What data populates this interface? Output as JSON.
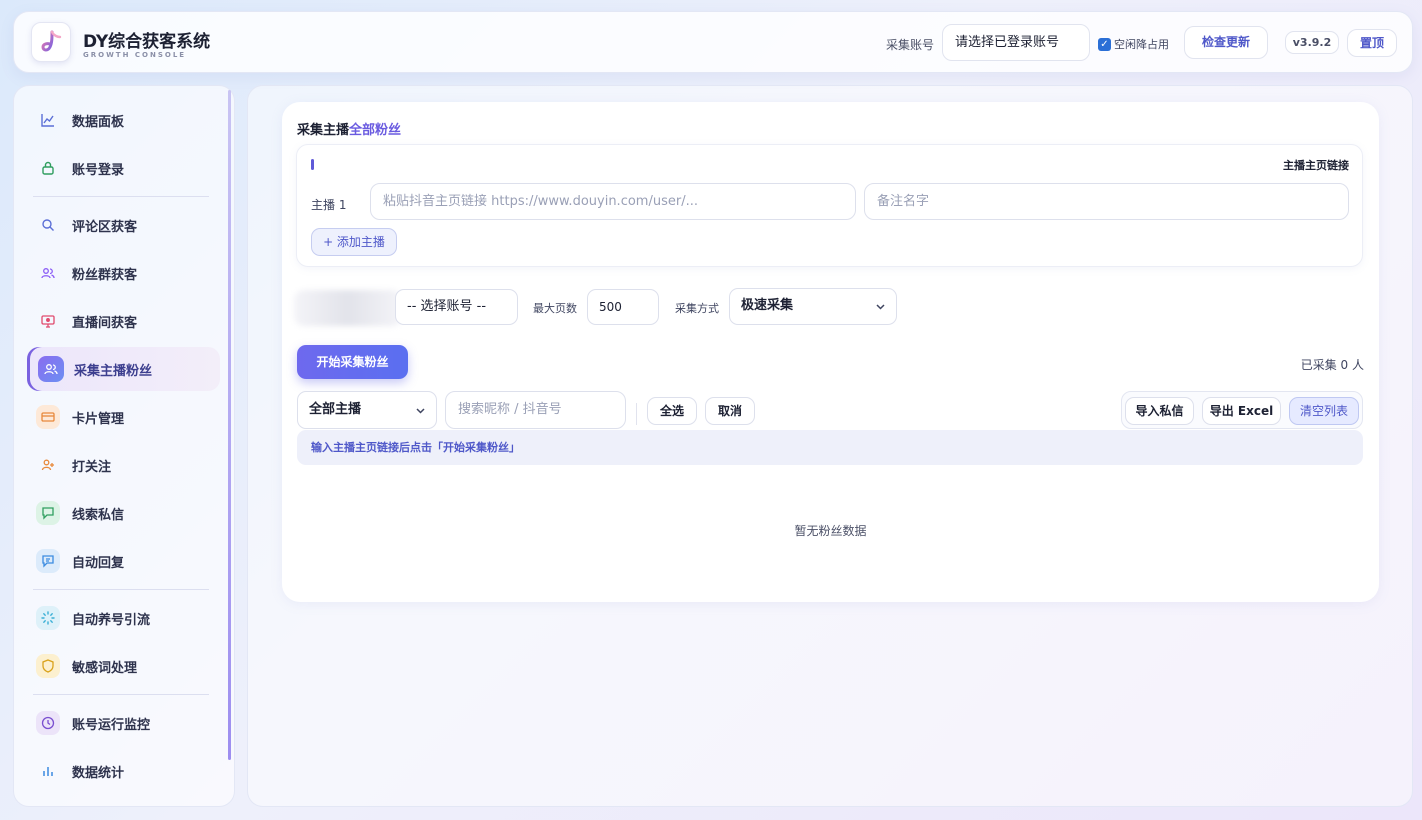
{
  "app": {
    "title": "DY综合获客系统",
    "subtitle": "GROWTH CONSOLE"
  },
  "topbar": {
    "account_label": "采集账号",
    "account_select": "请选择已登录账号",
    "idle_checkbox": {
      "label": "空闲降占用",
      "checked": true
    },
    "check_update": "检查更新",
    "version": "v3.9.2",
    "pin_top": "置顶"
  },
  "sidebar": {
    "items": [
      {
        "label": "数据面板",
        "icon": "chart-line-icon",
        "color": "#5b6fd6"
      },
      {
        "label": "账号登录",
        "icon": "lock-icon",
        "color": "#2f9e5f"
      },
      {
        "label": "评论区获客",
        "icon": "search-icon",
        "color": "#5b6fd6"
      },
      {
        "label": "粉丝群获客",
        "icon": "users-icon",
        "color": "#8b5cf6"
      },
      {
        "label": "直播间获客",
        "icon": "monitor-icon",
        "color": "#e04b6e"
      },
      {
        "label": "采集主播粉丝",
        "icon": "users-icon",
        "color": "#ffffff",
        "active": true
      },
      {
        "label": "卡片管理",
        "icon": "card-icon",
        "color": "#e8893b"
      },
      {
        "label": "打关注",
        "icon": "user-plus-icon",
        "color": "#e8893b"
      },
      {
        "label": "线索私信",
        "icon": "message-icon",
        "color": "#2f9e5f"
      },
      {
        "label": "自动回复",
        "icon": "reply-icon",
        "color": "#3b8be0"
      },
      {
        "label": "自动养号引流",
        "icon": "loader-icon",
        "color": "#3bb0d6"
      },
      {
        "label": "敏感词处理",
        "icon": "shield-icon",
        "color": "#d9a21b"
      },
      {
        "label": "账号运行监控",
        "icon": "clock-icon",
        "color": "#7a4fd0"
      },
      {
        "label": "数据统计",
        "icon": "bar-chart-icon",
        "color": "#3b8be0"
      }
    ]
  },
  "main": {
    "title_prefix": "采集主播",
    "title_highlight": "全部粉丝",
    "link_section_label": "主播主页链接",
    "host_label": "主播 1",
    "link_placeholder": "粘贴抖音主页链接 https://www.douyin.com/user/...",
    "note_placeholder": "备注名字",
    "add_host": "+ 添加主播",
    "account_select": "-- 选择账号 --",
    "max_pages_label": "最大页数",
    "max_pages_value": "500",
    "mode_label": "采集方式",
    "mode_value": "极速采集",
    "start_button": "开始采集粉丝",
    "collected_count": "已采集 0 人",
    "host_filter": "全部主播",
    "search_placeholder": "搜索昵称 / 抖音号",
    "select_all": "全选",
    "cancel": "取消",
    "import_dm": "导入私信",
    "export_excel": "导出 Excel",
    "clear_list": "清空列表",
    "hint": "输入主播主页链接后点击「开始采集粉丝」",
    "empty_text": "暂无粉丝数据"
  }
}
